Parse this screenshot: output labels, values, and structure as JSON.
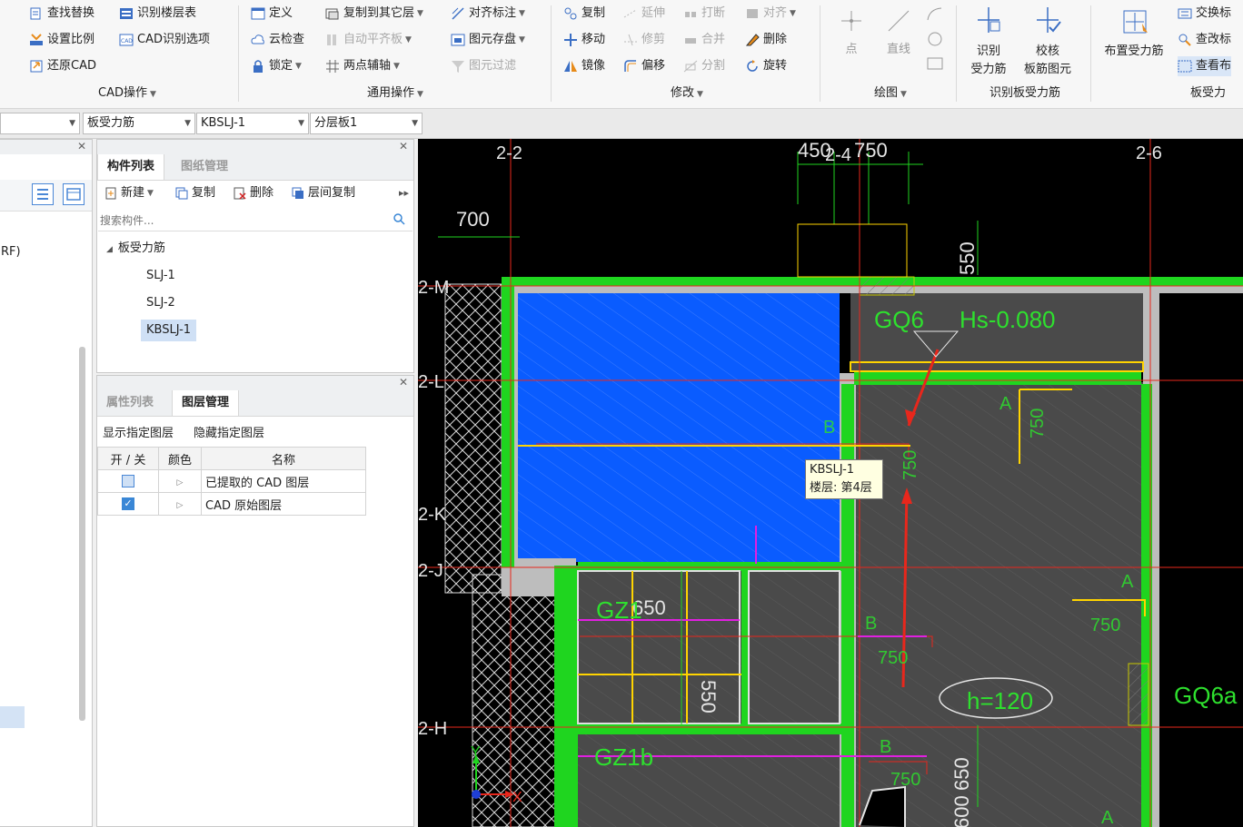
{
  "ribbon": {
    "groups": [
      {
        "label": "CAD操作"
      },
      {
        "label": "通用操作"
      },
      {
        "label": "修改"
      },
      {
        "label": "绘图"
      },
      {
        "label": "识别板受力筋"
      },
      {
        "label": "板受力"
      }
    ],
    "cad_ops": {
      "find_replace": "查找替换",
      "identify_floor_table": "识别楼层表",
      "set_scale": "设置比例",
      "cad_identify_options": "CAD识别选项",
      "restore_cad": "还原CAD"
    },
    "common_ops": {
      "define": "定义",
      "copy_to_other_floor": "复制到其它层",
      "align_annotation": "对齐标注",
      "cloud_check": "云检查",
      "auto_flat_slab": "自动平齐板",
      "element_storage": "图元存盘",
      "lock": "锁定",
      "two_point_axis": "两点辅轴",
      "element_filter": "图元过滤"
    },
    "modify": {
      "copy": "复制",
      "extend": "延伸",
      "break": "打断",
      "align": "对齐",
      "move": "移动",
      "trim": "修剪",
      "merge": "合并",
      "delete": "删除",
      "mirror": "镜像",
      "offset": "偏移",
      "split": "分割",
      "rotate": "旋转"
    },
    "draw": {
      "point": "点",
      "line": "直线"
    },
    "identify_slab": {
      "identify_label_1": "识别",
      "identify_label_2": "受力筋",
      "verify_label_1": "校核",
      "verify_label_2": "板筋图元"
    },
    "slab_rebar": {
      "place": "布置受力筋",
      "swap": "交换标",
      "modify_mark": "查改标",
      "view_layout": "查看布"
    }
  },
  "toolbar": {
    "combo1": "",
    "combo2": "板受力筋",
    "combo3": "KBSLJ-1",
    "combo4": "分层板1"
  },
  "left_panel": {
    "partial_text": "RF)"
  },
  "component_panel": {
    "tab_active": "构件列表",
    "tab_inactive": "图纸管理",
    "new_btn": "新建",
    "copy_btn": "复制",
    "delete_btn": "删除",
    "floor_copy_btn": "层间复制",
    "search_placeholder": "搜索构件...",
    "tree_root": "板受力筋",
    "items": [
      "SLJ-1",
      "SLJ-2",
      "KBSLJ-1"
    ]
  },
  "layer_panel": {
    "tab_inactive": "属性列表",
    "tab_active": "图层管理",
    "show_layer": "显示指定图层",
    "hide_layer": "隐藏指定图层",
    "col_toggle": "开 / 关",
    "col_color": "颜色",
    "col_name": "名称",
    "rows": [
      {
        "name": "已提取的 CAD 图层",
        "checked": false
      },
      {
        "name": "CAD 原始图层",
        "checked": true
      }
    ]
  },
  "canvas": {
    "axis_labels": [
      "2-2",
      "2-4",
      "2-6",
      "2-M",
      "2-L",
      "2-K",
      "2-J",
      "2-H"
    ],
    "dims": [
      "700",
      "450",
      "750",
      "550",
      "650",
      "550",
      "650",
      "600"
    ],
    "annotations": [
      "GQ6",
      "Hs-0.080",
      "GQ6a",
      "GZ1",
      "GZ1b",
      "h=120",
      "750",
      "750",
      "750",
      "750",
      "750",
      "A",
      "B",
      "A",
      "B",
      "B",
      "A",
      "X",
      "Y"
    ],
    "tooltip_line1": "KBSLJ-1",
    "tooltip_line2": "楼层: 第4层"
  },
  "colors": {
    "green": "#1fd51f",
    "blue_slab": "#0a5cff",
    "gray_slab": "#4a4a4a",
    "red": "#e8271c",
    "magenta": "#e11fe1",
    "yellow": "#ffd400"
  }
}
